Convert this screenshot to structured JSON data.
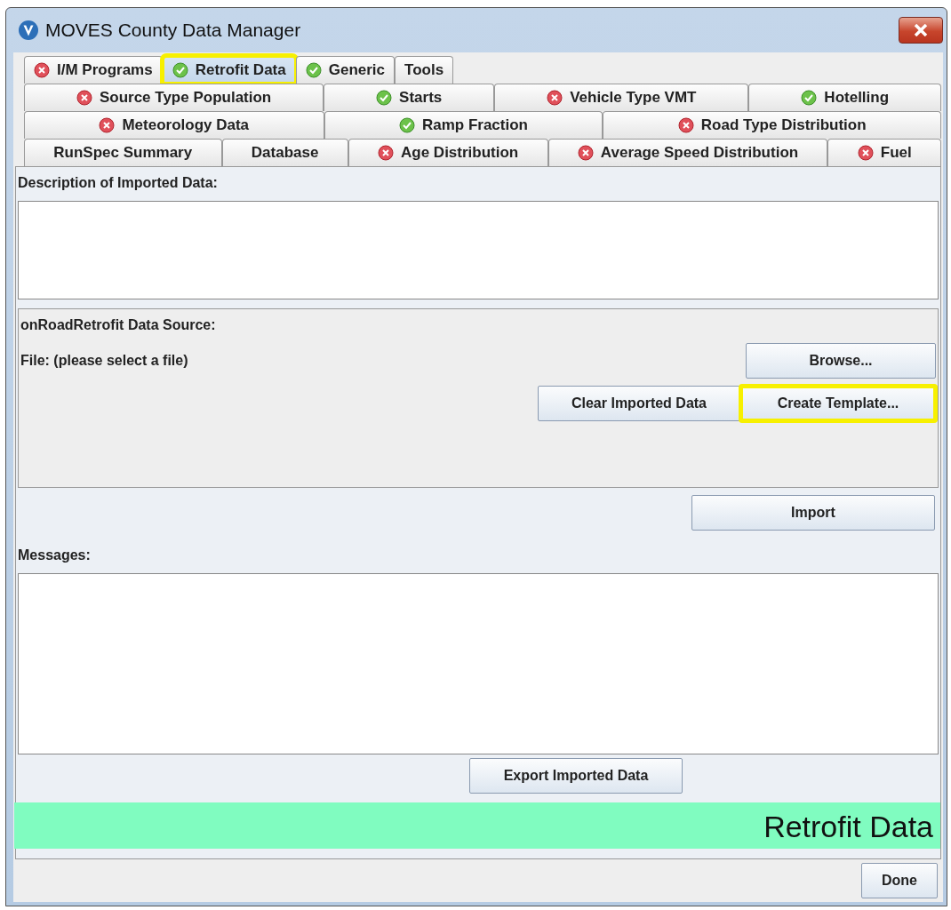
{
  "window": {
    "title": "MOVES County Data Manager"
  },
  "tab_rows": [
    [
      {
        "label": "I/M Programs",
        "kind": "error",
        "selected": false,
        "highlighted": false
      },
      {
        "label": "Retrofit Data",
        "kind": "ok",
        "selected": true,
        "highlighted": true
      },
      {
        "label": "Generic",
        "kind": "ok",
        "selected": false,
        "highlighted": false
      },
      {
        "label": "Tools",
        "kind": "plain",
        "selected": false,
        "highlighted": false
      }
    ],
    [
      {
        "label": "Source Type Population",
        "kind": "error",
        "selected": false,
        "highlighted": false
      },
      {
        "label": "Starts",
        "kind": "ok",
        "selected": false,
        "highlighted": false
      },
      {
        "label": "Vehicle Type VMT",
        "kind": "error",
        "selected": false,
        "highlighted": false
      },
      {
        "label": "Hotelling",
        "kind": "ok",
        "selected": false,
        "highlighted": false
      }
    ],
    [
      {
        "label": "Meteorology Data",
        "kind": "error",
        "selected": false,
        "highlighted": false
      },
      {
        "label": "Ramp Fraction",
        "kind": "ok",
        "selected": false,
        "highlighted": false
      },
      {
        "label": "Road Type Distribution",
        "kind": "error",
        "selected": false,
        "highlighted": false
      }
    ],
    [
      {
        "label": "RunSpec Summary",
        "kind": "plain",
        "selected": false,
        "highlighted": false
      },
      {
        "label": "Database",
        "kind": "plain",
        "selected": false,
        "highlighted": false
      },
      {
        "label": "Age Distribution",
        "kind": "error",
        "selected": false,
        "highlighted": false
      },
      {
        "label": "Average Speed Distribution",
        "kind": "error",
        "selected": false,
        "highlighted": false
      },
      {
        "label": "Fuel",
        "kind": "error",
        "selected": false,
        "highlighted": false
      }
    ]
  ],
  "description_label": "Description of Imported Data:",
  "data_source": {
    "title": "onRoadRetrofit Data Source:",
    "file_label": "File: (please select a file)",
    "buttons": [
      {
        "label": "Browse...",
        "highlighted": false
      },
      {
        "label": "Clear Imported Data",
        "highlighted": false
      },
      {
        "label": "Create Template...",
        "highlighted": true
      }
    ]
  },
  "import_button": "Import",
  "messages_label": "Messages:",
  "export_button": "Export Imported Data",
  "banner": "Retrofit Data",
  "done_button": "Done"
}
